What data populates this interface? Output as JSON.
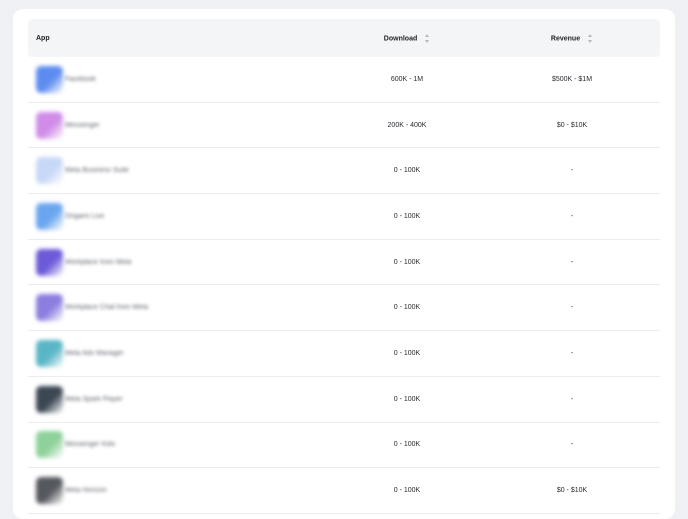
{
  "table": {
    "headers": {
      "app": "App",
      "download": "Download",
      "revenue": "Revenue"
    },
    "rows": [
      {
        "name": "Facebook",
        "download": "600K - 1M",
        "revenue": "$500K - $1M",
        "icon_color": "#5d8cf0"
      },
      {
        "name": "Messenger",
        "download": "200K - 400K",
        "revenue": "$0 - $10K",
        "icon_color": "#d08ce8"
      },
      {
        "name": "Meta Business Suite",
        "download": "0 - 100K",
        "revenue": "-",
        "icon_color": "#c7d8f6"
      },
      {
        "name": "Origami Live",
        "download": "0 - 100K",
        "revenue": "-",
        "icon_color": "#6aa6ef"
      },
      {
        "name": "Workplace from Meta",
        "download": "0 - 100K",
        "revenue": "-",
        "icon_color": "#6c5bd8"
      },
      {
        "name": "Workplace Chat from Meta",
        "download": "0 - 100K",
        "revenue": "-",
        "icon_color": "#8b7ee0"
      },
      {
        "name": "Meta Ads Manager",
        "download": "0 - 100K",
        "revenue": "-",
        "icon_color": "#5ab6c6"
      },
      {
        "name": "Meta Spark Player",
        "download": "0 - 100K",
        "revenue": "-",
        "icon_color": "#3c4754"
      },
      {
        "name": "Messenger Kids",
        "download": "0 - 100K",
        "revenue": "-",
        "icon_color": "#8fd19a"
      },
      {
        "name": "Meta Horizon",
        "download": "0 - 100K",
        "revenue": "$0 - $10K",
        "icon_color": "#55585e"
      }
    ]
  }
}
